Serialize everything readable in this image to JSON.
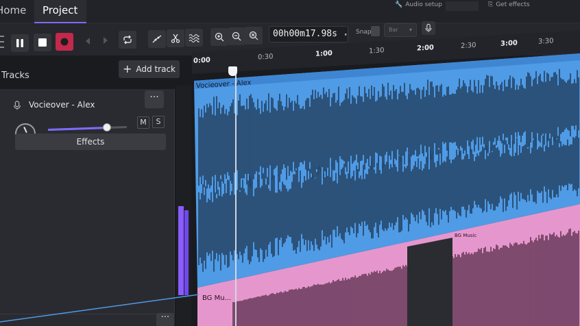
{
  "tabs": {
    "home": "Home",
    "project": "Project"
  },
  "top_right": {
    "audio_setup": "Audio setup",
    "get_effects": "Get effects"
  },
  "toolbar": {
    "timecode": "00h00m17.98s",
    "snap_label": "Snap",
    "snap_value": "Bar"
  },
  "ruler": {
    "ticks": [
      {
        "label": "0:00",
        "major": true
      },
      {
        "label": "0:30",
        "major": false
      },
      {
        "label": "1:00",
        "major": true
      },
      {
        "label": "1:30",
        "major": false
      },
      {
        "label": "2:00",
        "major": true
      },
      {
        "label": "2:30",
        "major": false
      },
      {
        "label": "3:00",
        "major": true
      },
      {
        "label": "3:30",
        "major": false
      }
    ]
  },
  "tracks_panel": {
    "title": "Tracks",
    "add_track": "Add track",
    "track": {
      "name": "Vocieover - Alex",
      "mute": "M",
      "solo": "S",
      "effects": "Effects",
      "volume": 0.75
    }
  },
  "clips": {
    "voiceover": "Vocieover - Alex",
    "bg_music": "BG Mu...",
    "bg_music_2": "BG Music"
  },
  "colors": {
    "accent": "#7d6cff",
    "record": "#c3294a",
    "voice_clip": "#4f9be6",
    "music_clip": "#e597cd"
  }
}
